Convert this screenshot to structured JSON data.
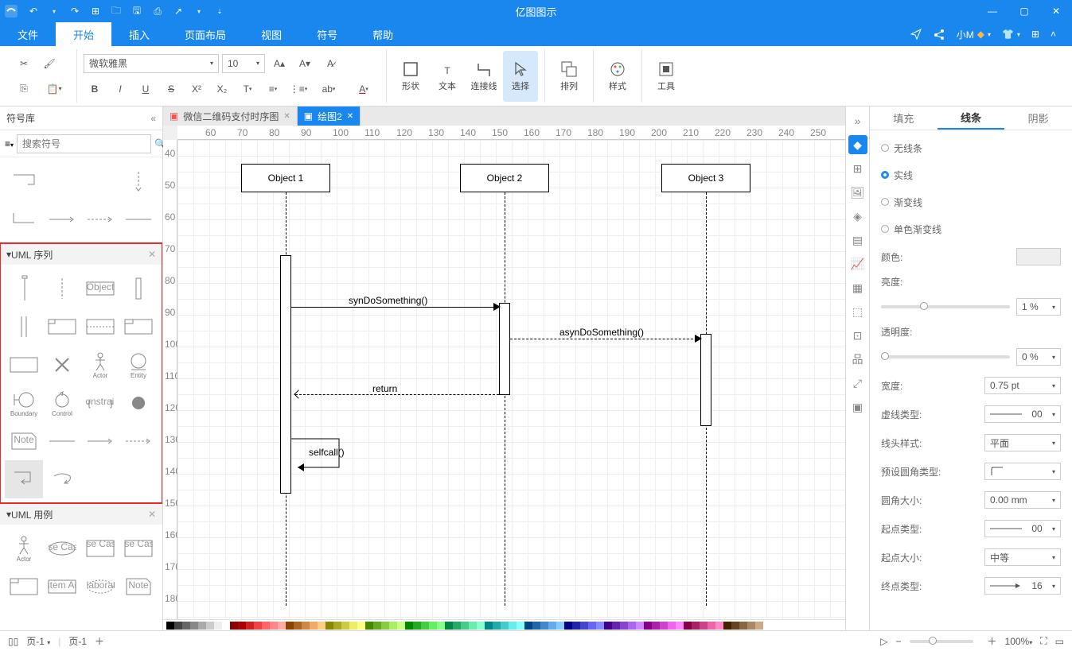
{
  "app": {
    "title": "亿图图示"
  },
  "menu": {
    "file": "文件",
    "home": "开始",
    "insert": "插入",
    "layout": "页面布局",
    "view": "视图",
    "symbol": "符号",
    "help": "帮助",
    "user": "小M"
  },
  "ribbon": {
    "font": "微软雅黑",
    "size": "10",
    "shape": "形状",
    "text": "文本",
    "connector": "连接线",
    "select": "选择",
    "arrange": "排列",
    "style": "样式",
    "tools": "工具"
  },
  "left": {
    "title": "符号库",
    "search_ph": "搜索符号",
    "sec_seq": "UML 序列",
    "sec_use": "UML 用例",
    "actor": "Actor",
    "entity": "Entity",
    "boundary": "Boundary",
    "control": "Control",
    "object": "Object",
    "note": "Note",
    "constraint": "Constraint",
    "usecase": "Use Case",
    "usecase2": "Use Case",
    "usecase3": "Use Case",
    "sysactor": "System Actor",
    "collab": "Collaboration"
  },
  "tabs": {
    "t1": "微信二维码支付时序图",
    "t2": "绘图2"
  },
  "diagram": {
    "obj1": "Object 1",
    "obj2": "Object 2",
    "obj3": "Object 3",
    "m1": "synDoSomething()",
    "m2": "asynDoSomething()",
    "m3": "return",
    "m4": "selfcall()"
  },
  "ruler_h": [
    "60",
    "70",
    "80",
    "90",
    "100",
    "110",
    "120",
    "130",
    "140",
    "150",
    "160",
    "170",
    "180",
    "190",
    "200",
    "210",
    "220",
    "230",
    "240",
    "250"
  ],
  "ruler_v": [
    "40",
    "50",
    "60",
    "70",
    "80",
    "90",
    "100",
    "110",
    "120",
    "130",
    "140",
    "150",
    "160",
    "170",
    "180"
  ],
  "prop": {
    "fill": "填充",
    "line": "线条",
    "shadow": "阴影",
    "noline": "无线条",
    "solid": "实线",
    "gradient": "渐变线",
    "mono": "单色渐变线",
    "color": "颜色:",
    "brightness": "亮度:",
    "b_val": "1 %",
    "opacity": "透明度:",
    "o_val": "0 %",
    "width": "宽度:",
    "w_val": "0.75 pt",
    "dash": "虚线类型:",
    "d_val": "00",
    "head": "线头样式:",
    "h_val": "平面",
    "round": "预设圆角类型:",
    "rsize": "圆角大小:",
    "r_val": "0.00 mm",
    "start": "起点类型:",
    "s_val": "00",
    "ssize": "起点大小:",
    "ss_val": "中等",
    "end": "终点类型:",
    "e_val": "16"
  },
  "status": {
    "page": "页-1",
    "sheet": "页-1",
    "zoom": "100%"
  }
}
